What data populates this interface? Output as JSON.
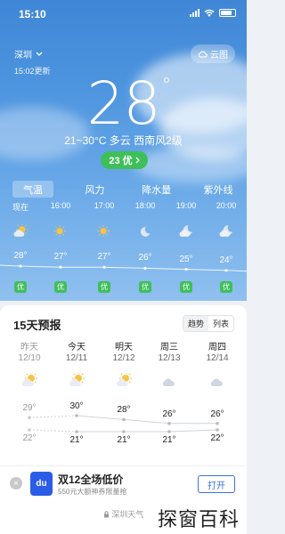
{
  "status": {
    "time": "15:10"
  },
  "header": {
    "city": "深圳",
    "updated": "15:02更新",
    "cloud_map_label": "云图"
  },
  "current": {
    "temperature": "28",
    "degree": "°",
    "condition_line": "21~30°C  多云  西南风2级",
    "aqi_label": "23 优"
  },
  "tabs": [
    "气温",
    "风力",
    "降水量",
    "紫外线"
  ],
  "hourly": [
    {
      "time": "现在",
      "icon": "cloudy-sun-icon",
      "temp": "28°",
      "aqi": "优"
    },
    {
      "time": "16:00",
      "icon": "sun-icon",
      "temp": "27°",
      "aqi": "优"
    },
    {
      "time": "17:00",
      "icon": "sun-icon",
      "temp": "27°",
      "aqi": "优"
    },
    {
      "time": "18:00",
      "icon": "moon-icon",
      "temp": "26°",
      "aqi": "优"
    },
    {
      "time": "19:00",
      "icon": "cloudy-moon-icon",
      "temp": "25°",
      "aqi": "优"
    },
    {
      "time": "20:00",
      "icon": "cloudy-moon-icon",
      "temp": "24°",
      "aqi": "优"
    }
  ],
  "forecast": {
    "title": "15天预报",
    "toggle": [
      "趋势",
      "列表"
    ],
    "days": [
      {
        "name": "昨天",
        "date": "12/10",
        "icon": "cloudy-sun-icon",
        "high": "29°",
        "low": "22°"
      },
      {
        "name": "今天",
        "date": "12/11",
        "icon": "cloudy-sun-icon",
        "high": "30°",
        "low": "21°"
      },
      {
        "name": "明天",
        "date": "12/12",
        "icon": "cloudy-sun-icon",
        "high": "28°",
        "low": "21°"
      },
      {
        "name": "周三",
        "date": "12/13",
        "icon": "cloud-icon",
        "high": "26°",
        "low": "21°"
      },
      {
        "name": "周四",
        "date": "12/14",
        "icon": "cloud-icon",
        "high": "26°",
        "low": "22°"
      }
    ]
  },
  "ad": {
    "close": "×",
    "logo": "du",
    "title": "双12全场低价",
    "subtitle": "550元大额神券限量抢",
    "button": "打开"
  },
  "footer": {
    "source": "深圳天气"
  },
  "watermark": "探窗百科",
  "colors": {
    "aqi_good": "#3fbf5a",
    "sky_top": "#3f86d6",
    "ad_button": "#3a73e0"
  }
}
